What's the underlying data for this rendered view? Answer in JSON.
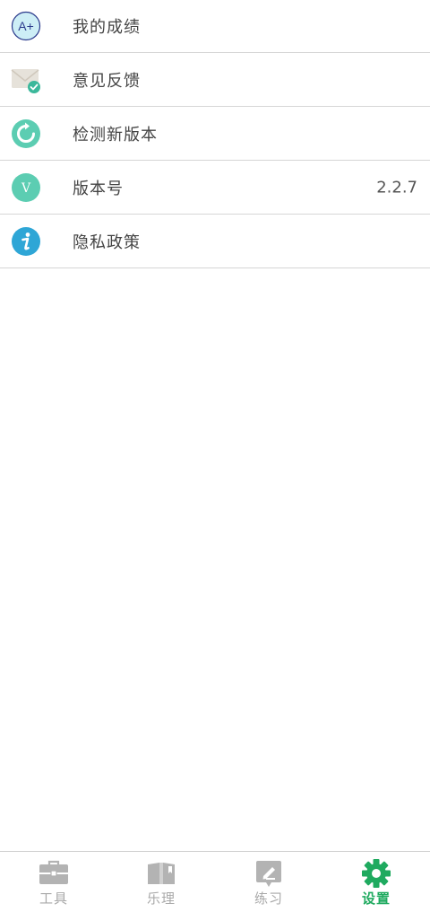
{
  "settings": {
    "items": [
      {
        "label": "我的成绩",
        "icon": "grade-a-plus-icon"
      },
      {
        "label": "意见反馈",
        "icon": "mail-check-icon"
      },
      {
        "label": "检测新版本",
        "icon": "refresh-icon"
      },
      {
        "label": "版本号",
        "icon": "version-v-icon",
        "value": "2.2.7"
      },
      {
        "label": "隐私政策",
        "icon": "info-icon"
      }
    ],
    "grade_icon_text": "A+",
    "version_icon_text": "V"
  },
  "tabbar": {
    "tabs": [
      {
        "label": "工具",
        "icon": "toolbox-icon",
        "active": false
      },
      {
        "label": "乐理",
        "icon": "book-icon",
        "active": false
      },
      {
        "label": "练习",
        "icon": "practice-pen-icon",
        "active": false
      },
      {
        "label": "设置",
        "icon": "gear-icon",
        "active": true
      }
    ],
    "active_color": "#1faa5f",
    "inactive_color": "#a9a9a9"
  },
  "colors": {
    "teal": "#5ccdb2",
    "blue": "#2ea6d6",
    "divider": "#d6d6d6"
  }
}
